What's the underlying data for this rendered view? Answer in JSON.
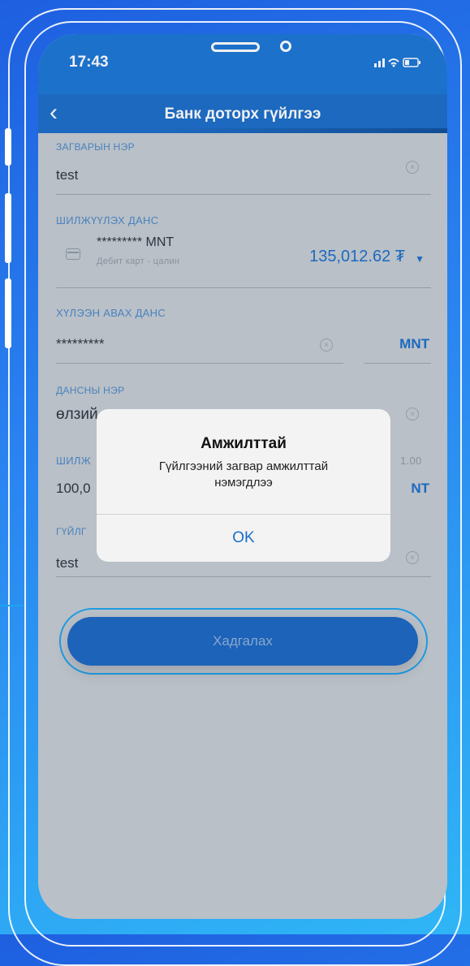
{
  "status_bar": {
    "time": "17:43",
    "icons": "..ıl ≋ ▭"
  },
  "nav": {
    "title": "Банк доторх гүйлгээ"
  },
  "form": {
    "template_name": {
      "label": "ЗАГВАРЫН НЭР",
      "value": "test"
    },
    "source_account": {
      "label": "ШИЛЖҮҮЛЭХ ДАНС",
      "masked": "********* MNT",
      "subtitle": "Дебит карт - цалин",
      "balance": "135,012.62 ₮"
    },
    "receiver_account": {
      "label": "ХҮЛЭЭН АВАХ ДАНС",
      "value": "*********",
      "currency": "MNT"
    },
    "account_name": {
      "label": "ДАНСНЫ НЭР",
      "value": "өлзий"
    },
    "amount": {
      "label": "ШИЛЖ",
      "value": "100,0",
      "rate": "1.00",
      "currency": "NT"
    },
    "description": {
      "label": "ГҮЙЛГ",
      "value": "test"
    }
  },
  "save_button": {
    "label": "Хадгалах"
  },
  "alert": {
    "title": "Амжилттай",
    "message": "Гүйлгээний загвар амжилттай нэмэгдлээ",
    "ok_label": "OK"
  },
  "colors": {
    "primary": "#1a6dc9",
    "background": "#c4cbd2",
    "frame_gradient_start": "#1e5fe0",
    "frame_gradient_end": "#2fb6f6"
  }
}
